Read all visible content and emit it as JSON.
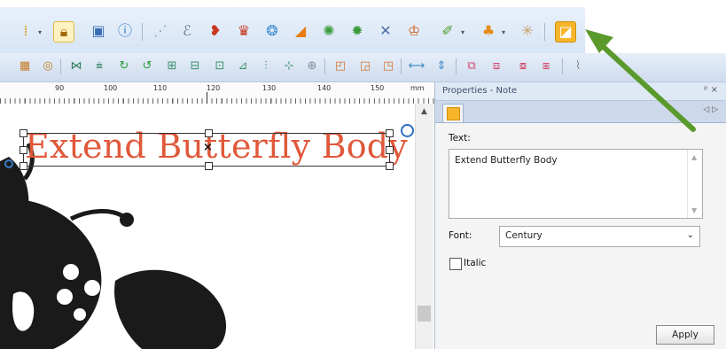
{
  "toolbar_row1": {
    "icons": [
      "stitch-sequence-icon",
      "lock-icon",
      "film-icon",
      "info-icon",
      "zigzag-icon",
      "outline-icon",
      "satin-shape-icon",
      "shell-icon",
      "ring-icon",
      "flag-icon",
      "grass-icon",
      "fan-icon",
      "cross-icon",
      "crown-icon",
      "brush-icon",
      "trefoil-icon",
      "sparkle-icon",
      "note-icon"
    ]
  },
  "toolbar_row2": {
    "icons": [
      "hatch-icon",
      "circle-icon",
      "mirror-icon",
      "align-icon",
      "rotate-icon",
      "rotate-left-icon",
      "distribute-icon",
      "arrange-icon",
      "group-icon",
      "steps-icon",
      "center-icon",
      "plus-align-icon",
      "stack-icon",
      "layers-icon",
      "frame-icon",
      "width-icon",
      "height-icon",
      "select-icon",
      "select-red-icon",
      "copy-icon",
      "paste-icon",
      "paperclip-icon"
    ]
  },
  "ruler": {
    "labels": [
      "90",
      "100",
      "110",
      "120",
      "130",
      "140",
      "150",
      "mm"
    ]
  },
  "canvas": {
    "note_text": "Extend Butterfly Body"
  },
  "properties": {
    "title": "Properties - Note",
    "pin_glyph": "ᵖ ×",
    "nav_glyph": "◁ ▷",
    "text_label": "Text:",
    "text_value": "Extend Butterfly Body",
    "font_label": "Font:",
    "font_value": "Century",
    "italic_label": "Italic",
    "italic_checked": false,
    "apply_label": "Apply"
  },
  "colors": {
    "note_text": "#e0583a",
    "arrow": "#5a9a2d",
    "panel_bg": "#f4f4f4",
    "toolbar_bg": "#d6e4f5"
  }
}
